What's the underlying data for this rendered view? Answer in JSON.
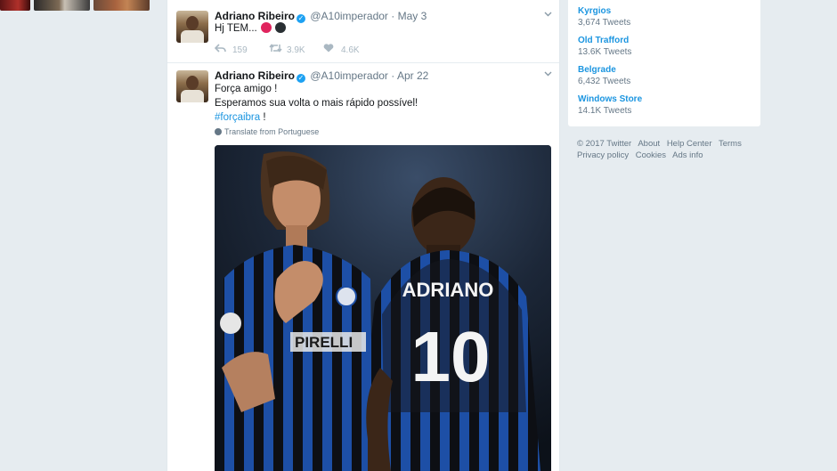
{
  "tweets": [
    {
      "name": "Adriano Ribeiro",
      "handle": "@A10imperador",
      "separator": "·",
      "date": "May 3",
      "text": "Hj TEM...",
      "emoji_colors": [
        "#e0245e",
        "#292f33"
      ],
      "replies": "159",
      "retweets": "3.9K",
      "likes": "4.6K"
    },
    {
      "name": "Adriano Ribeiro",
      "handle": "@A10imperador",
      "separator": "·",
      "date": "Apr 22",
      "lines": [
        "Força amigo !",
        "Esperamos sua volta o mais rápido possível!"
      ],
      "hashtag": "#forçaibra",
      "hashtag_suffix": " !",
      "translate": "Translate from Portuguese",
      "photo": {
        "jersey_text_left": "PIRELLI",
        "jersey_name": "ADRIANO",
        "jersey_number": "10"
      }
    }
  ],
  "trends": [
    {
      "name": "Kyrgios",
      "count": "3,674 Tweets"
    },
    {
      "name": "Old Trafford",
      "count": "13.6K Tweets"
    },
    {
      "name": "Belgrade",
      "count": "6,432 Tweets"
    },
    {
      "name": "Windows Store",
      "count": "14.1K Tweets"
    }
  ],
  "footer": {
    "copyright": "© 2017 Twitter",
    "about": "About",
    "help": "Help Center",
    "terms": "Terms",
    "privacy": "Privacy policy",
    "cookies": "Cookies",
    "ads": "Ads info"
  },
  "icons": {
    "verified": "verified-badge-icon",
    "reply": "reply-icon",
    "retweet": "retweet-icon",
    "like": "heart-icon",
    "caret": "chevron-down-icon",
    "globe": "globe-icon"
  },
  "colors": {
    "link": "#1b95e0",
    "muted": "#657786",
    "background": "#e6ecf0"
  }
}
